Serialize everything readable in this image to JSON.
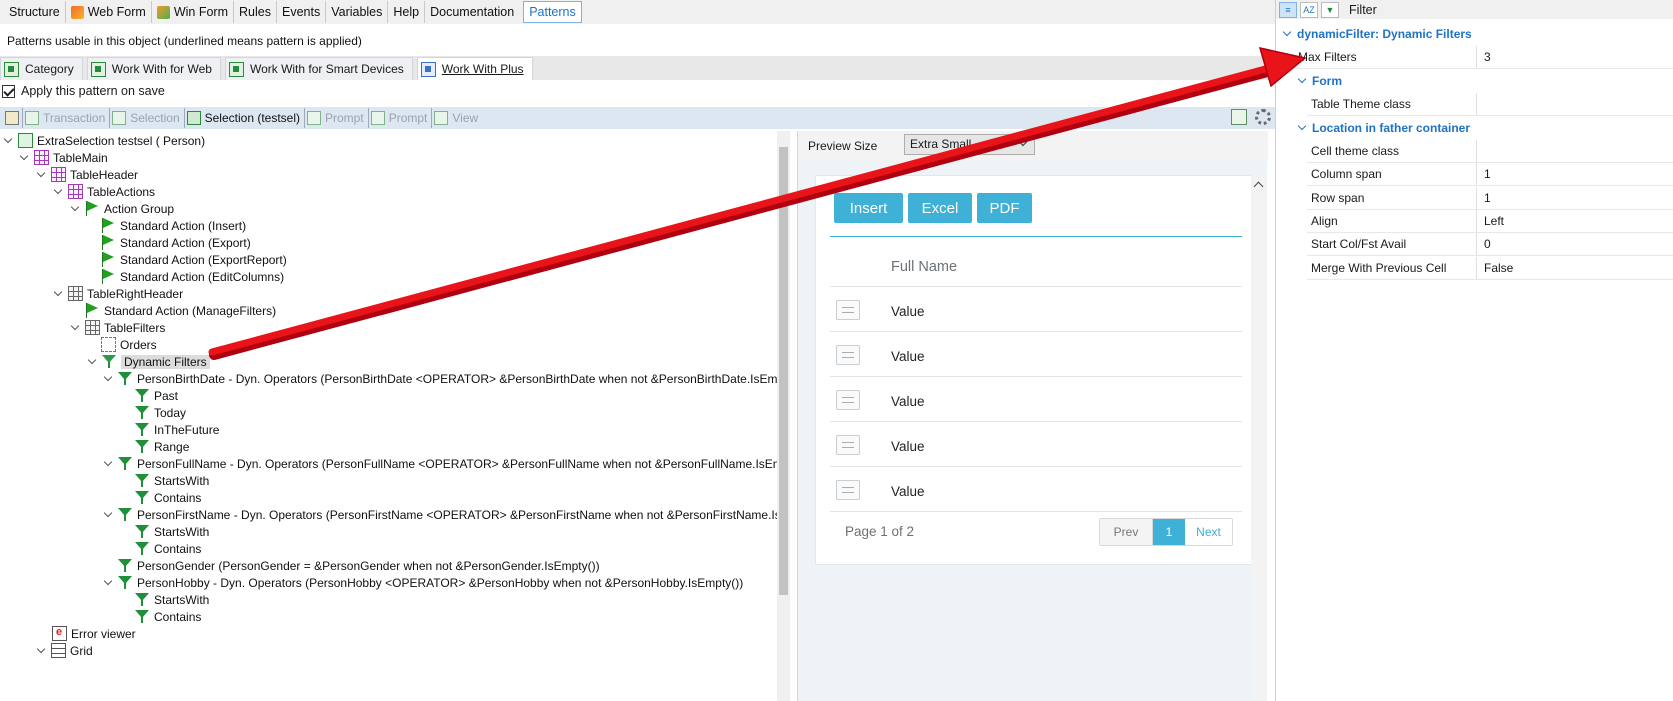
{
  "top_tabs": [
    "Structure",
    "Web Form",
    "Win Form",
    "Rules",
    "Events",
    "Variables",
    "Help",
    "Documentation",
    "Patterns"
  ],
  "usable_label": "Patterns usable in this object (underlined means pattern is applied)",
  "pattern_tabs": [
    "Category",
    "Work With for Web",
    "Work With for Smart Devices",
    "Work With Plus"
  ],
  "apply_label": "Apply this pattern on save",
  "instances": [
    "Transaction",
    "Selection",
    "Selection (testsel)",
    "Prompt",
    "Prompt",
    "View"
  ],
  "tree": {
    "root": "ExtraSelection testsel ( Person)",
    "table_main": "TableMain",
    "table_header": "TableHeader",
    "table_actions": "TableActions",
    "action_group": "Action Group",
    "actions": [
      "Standard Action (Insert)",
      "Standard Action (Export)",
      "Standard Action (ExportReport)",
      "Standard Action (EditColumns)"
    ],
    "table_right_header": "TableRightHeader",
    "manage_filters": "Standard Action (ManageFilters)",
    "table_filters": "TableFilters",
    "orders": "Orders",
    "dynamic_filters": "Dynamic Filters",
    "birth_date": "PersonBirthDate - Dyn. Operators (PersonBirthDate  <OPERATOR> &PersonBirthDate when not &PersonBirthDate.IsEmpty())",
    "birth_ops": [
      "Past",
      "Today",
      "InTheFuture",
      "Range"
    ],
    "full_name": "PersonFullName - Dyn. Operators (PersonFullName  <OPERATOR> &PersonFullName when not &PersonFullName.IsEmpty())",
    "full_name_ops": [
      "StartsWith",
      "Contains"
    ],
    "first_name": "PersonFirstName - Dyn. Operators (PersonFirstName <OPERATOR> &PersonFirstName when not &PersonFirstName.IsEmpty",
    "first_name_ops": [
      "StartsWith",
      "Contains"
    ],
    "gender": "PersonGender (PersonGender = &PersonGender when not &PersonGender.IsEmpty())",
    "hobby": "PersonHobby - Dyn. Operators (PersonHobby <OPERATOR> &PersonHobby when not &PersonHobby.IsEmpty())",
    "hobby_ops": [
      "StartsWith",
      "Contains"
    ],
    "error_viewer": "Error viewer",
    "grid": "Grid"
  },
  "preview": {
    "size_label": "Preview Size",
    "size_value": "Extra Small",
    "buttons": [
      "Insert",
      "Excel",
      "PDF"
    ],
    "column_header": "Full Name",
    "rows": [
      "Value",
      "Value",
      "Value",
      "Value",
      "Value"
    ],
    "page_text": "Page 1 of 2",
    "pager_prev": "Prev",
    "pager_current": "1",
    "pager_next": "Next"
  },
  "properties": {
    "filter_label": "Filter",
    "section_main": "dynamicFilter: Dynamic Filters",
    "max_filters_key": "Max Filters",
    "max_filters_val": "3",
    "section_form": "Form",
    "table_theme_key": "Table Theme class",
    "table_theme_val": "",
    "section_location": "Location in father container",
    "rows": [
      {
        "k": "Cell theme class",
        "v": ""
      },
      {
        "k": "Column span",
        "v": "1"
      },
      {
        "k": "Row span",
        "v": "1"
      },
      {
        "k": "Align",
        "v": "Left"
      },
      {
        "k": "Start Col/Fst Avail",
        "v": "0"
      },
      {
        "k": "Merge With Previous Cell",
        "v": "False"
      }
    ]
  },
  "colors": {
    "accent": "#3fb0d6",
    "arrow": "#e8141a",
    "section_blue": "#1e73c8"
  }
}
